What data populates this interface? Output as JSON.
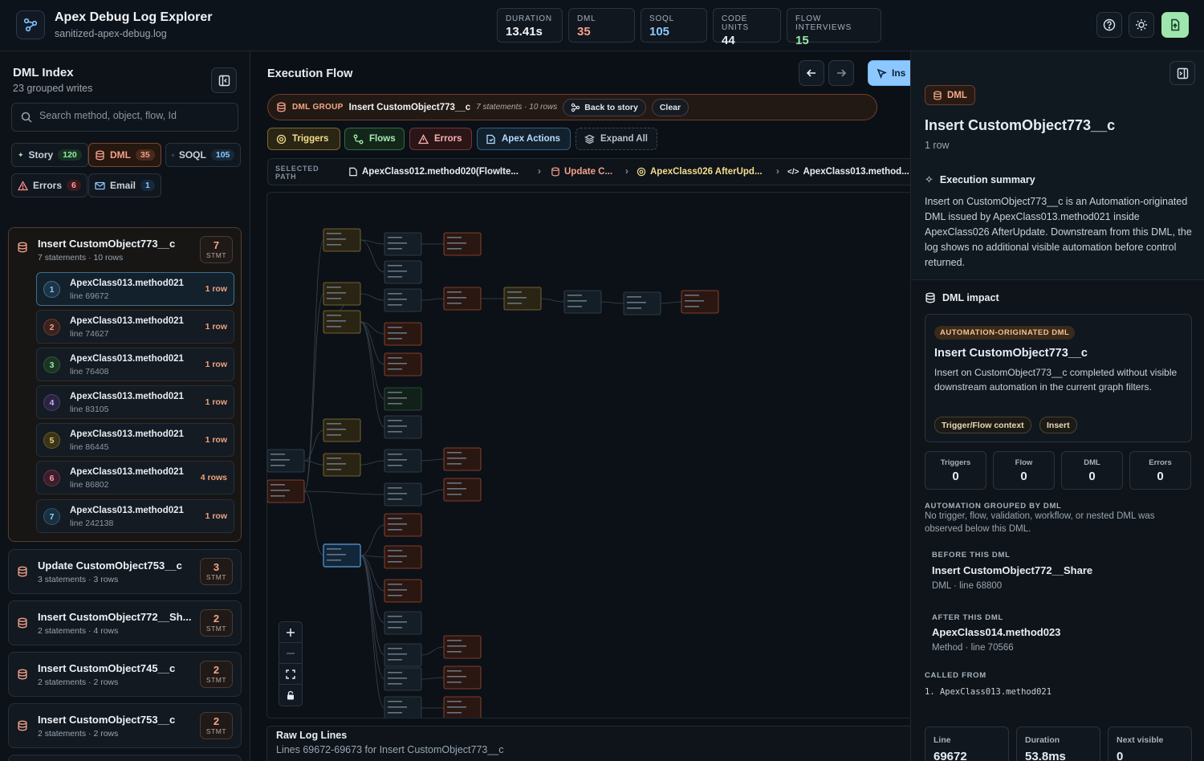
{
  "header": {
    "title": "Apex Debug Log Explorer",
    "file": "sanitized-apex-debug.log",
    "metrics": [
      {
        "label": "DURATION",
        "value": "13.41s",
        "color": "#f2f5f8"
      },
      {
        "label": "DML",
        "value": "35",
        "color": "#f4a18a"
      },
      {
        "label": "SOQL",
        "value": "105",
        "color": "#8cc8ff"
      },
      {
        "label": "CODE UNITS",
        "value": "44",
        "color": "#e6edf3"
      },
      {
        "label": "FLOW INTERVIEWS",
        "value": "15",
        "color": "#98e7a8"
      }
    ]
  },
  "left": {
    "title": "DML Index",
    "subtitle": "23 grouped writes",
    "search_placeholder": "Search method, object, flow, Id",
    "chips": [
      {
        "label": "Story",
        "count": "120"
      },
      {
        "label": "DML",
        "count": "35"
      },
      {
        "label": "SOQL",
        "count": "105"
      },
      {
        "label": "Errors",
        "count": "6"
      },
      {
        "label": "Email",
        "count": "1"
      }
    ],
    "active_group": {
      "title": "Insert CustomObject773__c",
      "sub": "7 statements · 10 rows",
      "count": "7",
      "unit": "STMT",
      "statements": [
        {
          "num": "1",
          "title": "ApexClass013.method021",
          "line": "line 69672",
          "rows": "1 row"
        },
        {
          "num": "2",
          "title": "ApexClass013.method021",
          "line": "line 74627",
          "rows": "1 row"
        },
        {
          "num": "3",
          "title": "ApexClass013.method021",
          "line": "line 76408",
          "rows": "1 row"
        },
        {
          "num": "4",
          "title": "ApexClass013.method021",
          "line": "line 83105",
          "rows": "1 row"
        },
        {
          "num": "5",
          "title": "ApexClass013.method021",
          "line": "line 86445",
          "rows": "1 row"
        },
        {
          "num": "6",
          "title": "ApexClass013.method021",
          "line": "line 86802",
          "rows": "4 rows"
        },
        {
          "num": "7",
          "title": "ApexClass013.method021",
          "line": "line 242138",
          "rows": "1 row"
        }
      ]
    },
    "groups": [
      {
        "title": "Update CustomObject753__c",
        "sub": "3 statements · 3 rows",
        "count": "3",
        "unit": "STMT"
      },
      {
        "title": "Insert CustomObject772__Sh...",
        "sub": "2 statements · 4 rows",
        "count": "2",
        "unit": "STMT"
      },
      {
        "title": "Insert CustomObject745__c",
        "sub": "2 statements · 2 rows",
        "count": "2",
        "unit": "STMT"
      },
      {
        "title": "Insert CustomObject753__c",
        "sub": "2 statements · 2 rows",
        "count": "2",
        "unit": "STMT"
      }
    ]
  },
  "center": {
    "title": "Execution Flow",
    "inspect_label": "Ins",
    "group_bar": {
      "kind": "DML GROUP",
      "title": "Insert CustomObject773__c",
      "sub": "7 statements · 10 rows",
      "back": "Back to story",
      "clear": "Clear"
    },
    "filters": [
      {
        "label": "Triggers"
      },
      {
        "label": "Flows"
      },
      {
        "label": "Errors"
      },
      {
        "label": "Apex Actions"
      },
      {
        "label": "Expand All"
      }
    ],
    "path_label": "SELECTED PATH",
    "crumbs": [
      {
        "text": "ApexClass012.method020(FlowIte..."
      },
      {
        "text": "Update C..."
      },
      {
        "text": "ApexClass026 AfterUpd..."
      },
      {
        "text": "ApexClass013.method..."
      }
    ],
    "raw": {
      "title": "Raw Log Lines",
      "sub": "Lines 69672-69673 for Insert CustomObject773__c"
    }
  },
  "right": {
    "badge": "DML",
    "title": "Insert CustomObject773__c",
    "rows": "1 row",
    "summary_title": "Execution summary",
    "summary": "Insert on CustomObject773__c is an Automation-originated DML issued by ApexClass013.method021 inside ApexClass026 AfterUpdate. Downstream from this DML, the log shows no additional visible automation before control returned.",
    "impact_title": "DML impact",
    "impact": {
      "tag": "AUTOMATION-ORIGINATED DML",
      "title": "Insert CustomObject773__c",
      "desc": "Insert on CustomObject773__c completed without visible downstream automation in the current graph filters.",
      "pills": [
        "Trigger/Flow context",
        "Insert"
      ]
    },
    "stats": [
      {
        "label": "Triggers",
        "value": "0"
      },
      {
        "label": "Flow",
        "value": "0"
      },
      {
        "label": "DML",
        "value": "0"
      },
      {
        "label": "Errors",
        "value": "0"
      }
    ],
    "grouped_caption": "AUTOMATION GROUPED BY DML",
    "grouped_text": "No trigger, flow, validation, workflow, or nested DML was observed below this DML.",
    "before_caption": "BEFORE THIS DML",
    "before_title": "Insert CustomObject772__Share",
    "before_sub": "DML · line 68800",
    "after_caption": "AFTER THIS DML",
    "after_title": "ApexClass014.method023",
    "after_sub": "Method · line 70566",
    "called_caption": "CALLED FROM",
    "called_item": "1. ApexClass013.method021",
    "bottom_cards": [
      {
        "label": "Line",
        "value": "69672"
      },
      {
        "label": "Duration",
        "value": "53.8ms"
      },
      {
        "label": "Next visible",
        "value": "0"
      }
    ]
  }
}
